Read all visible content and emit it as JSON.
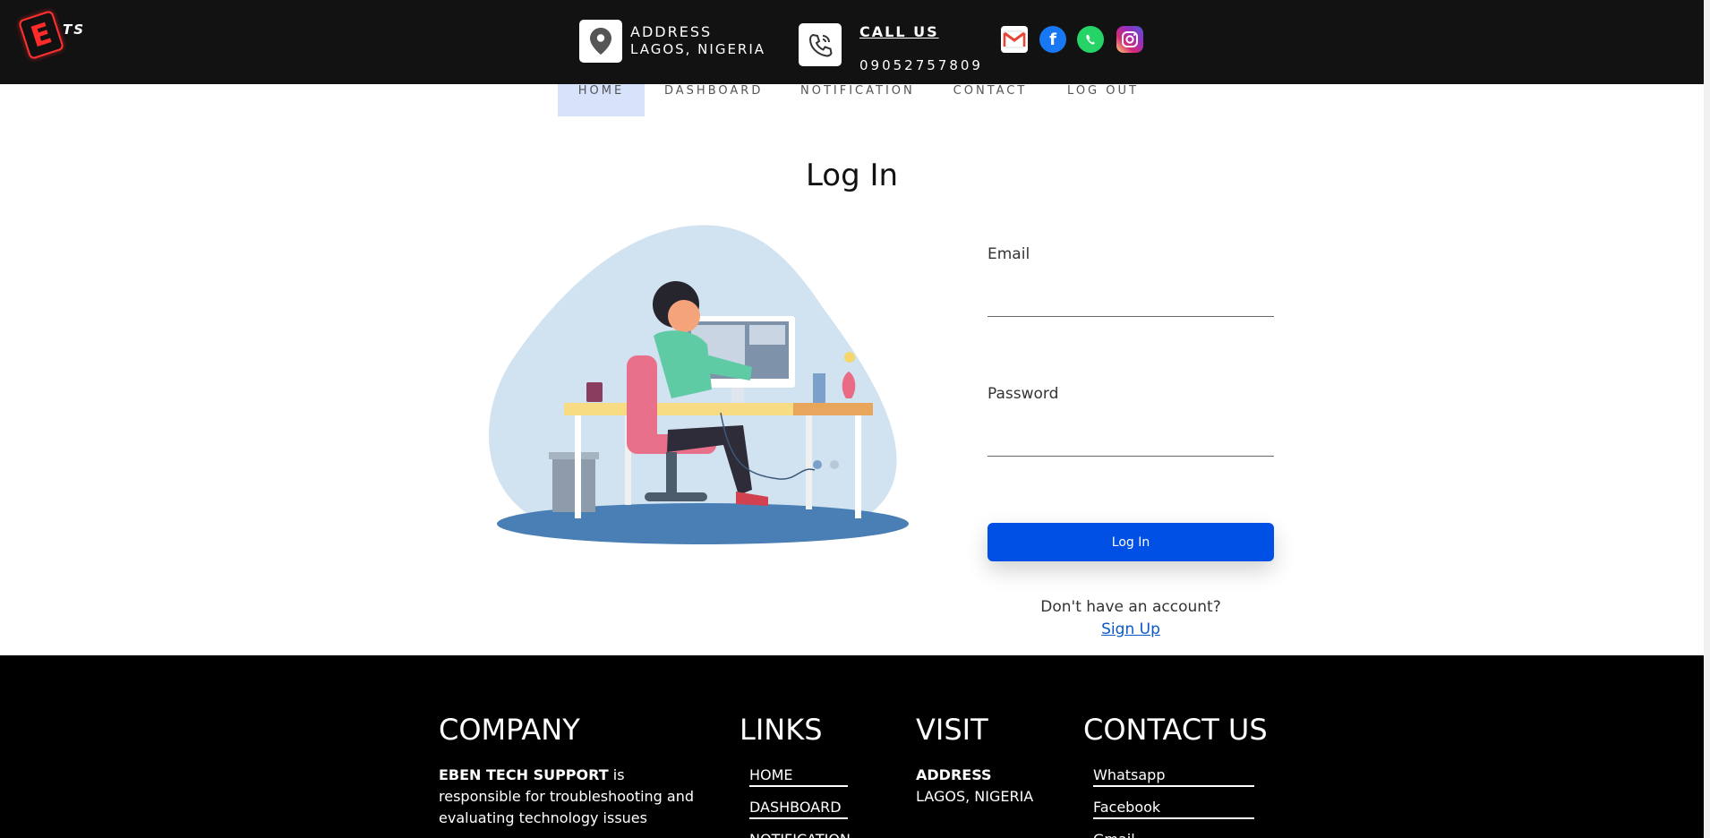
{
  "brand": {
    "logo_letter": "E",
    "logo_suffix": "TS"
  },
  "topbar": {
    "address_title": "ADDRESS",
    "address_value": "LAGOS, NIGERIA",
    "call_title": "CALL US",
    "call_number": "09052757809",
    "social_icons": [
      "gmail-icon",
      "facebook-icon",
      "whatsapp-icon",
      "instagram-icon"
    ]
  },
  "nav": {
    "home": "HOME",
    "dashboard": "DASHBOARD",
    "notification": "NOTIFICATION",
    "contact": "CONTACT",
    "logout": "LOG OUT",
    "active": "HOME"
  },
  "page": {
    "title": "Log In"
  },
  "form": {
    "email_label": "Email",
    "email_value": "",
    "password_label": "Password",
    "password_value": "",
    "submit_label": "Log In",
    "no_account_text": "Don't have an account?",
    "signup_link": "Sign Up"
  },
  "footer": {
    "company_heading": "COMPANY",
    "company_name": "EBEN TECH SUPPORT",
    "company_text": " is responsible for troubleshooting and evaluating technology issues",
    "links_heading": "LINKS",
    "links": [
      "HOME",
      "DASHBOARD",
      "NOTIFICATION"
    ],
    "visit_heading": "VISIT",
    "visit_title": "ADDRESS",
    "visit_value": "LAGOS, NIGERIA",
    "contact_heading": "CONTACT US",
    "contacts": [
      "Whatsapp",
      "Facebook",
      "Gmail"
    ]
  },
  "colors": {
    "topbar_bg": "#121212",
    "accent_blue": "#0050e6",
    "nav_active_bg": "#d7e3fb",
    "link_blue": "#0a58ca",
    "footer_bg": "#000000"
  }
}
